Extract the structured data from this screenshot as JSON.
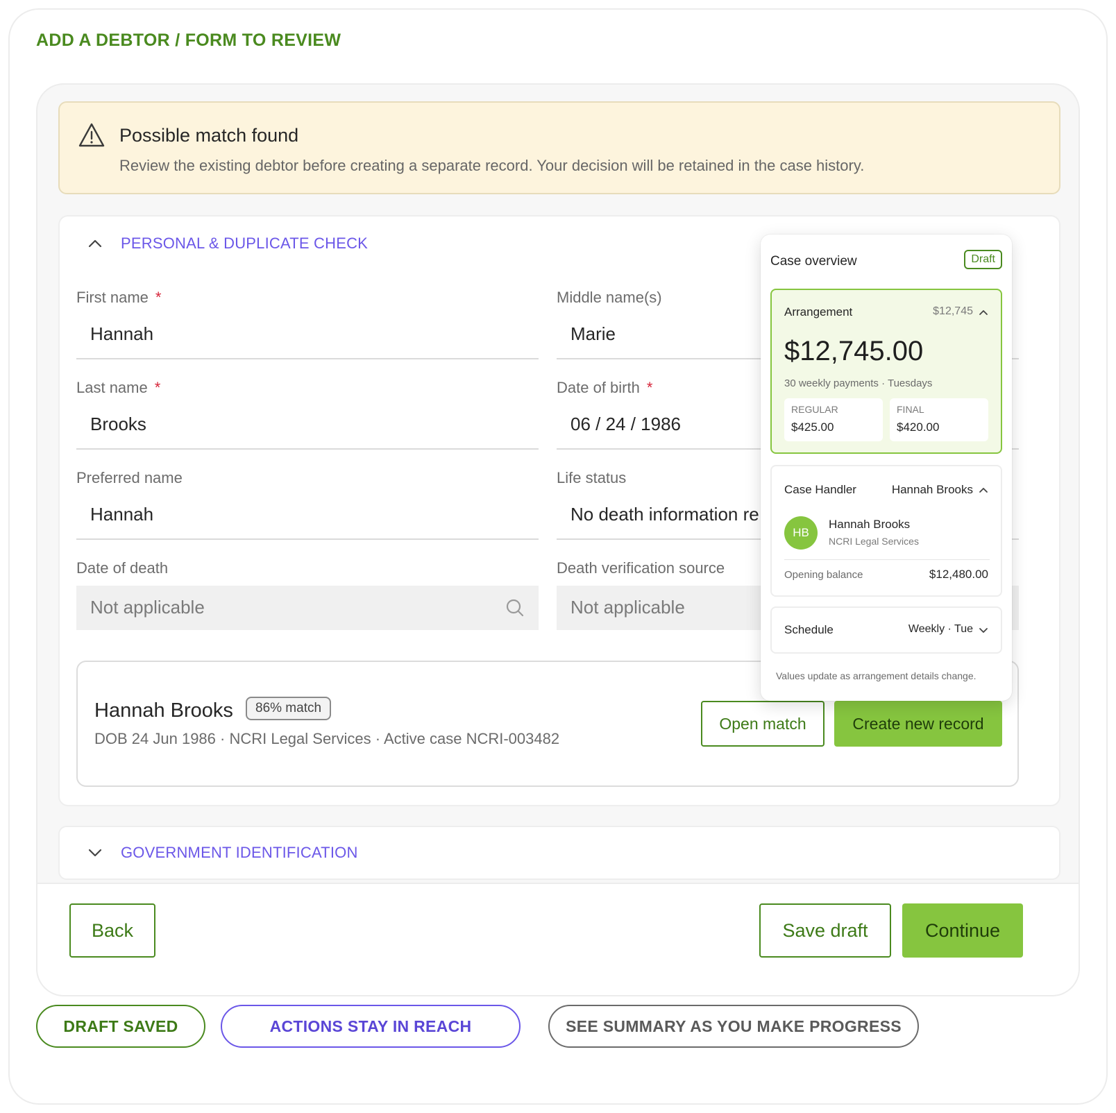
{
  "page": {
    "title": "ADD A DEBTOR / FORM TO REVIEW"
  },
  "alert": {
    "title": "Possible match found",
    "text": "Review the existing debtor before creating a separate record. Your decision will be retained in the case history.",
    "icon": "warning-triangle-icon"
  },
  "sections": {
    "personal": {
      "title": "PERSONAL & DUPLICATE CHECK",
      "expanded": true
    },
    "government": {
      "title": "GOVERNMENT IDENTIFICATION",
      "expanded": false
    }
  },
  "fields": {
    "first_name": {
      "label": "First name",
      "value": "Hannah",
      "required_mark": "*"
    },
    "middle_name": {
      "label": "Middle name(s)",
      "value": "Marie"
    },
    "last_name": {
      "label": "Last name",
      "value": "Brooks",
      "required_mark": "*"
    },
    "dob": {
      "label": "Date of birth",
      "value": "06 / 24 / 1986",
      "required_mark": "*"
    },
    "preferred_name": {
      "label": "Preferred name",
      "value": "Hannah"
    },
    "life_status": {
      "label": "Life status",
      "value": "No death information re"
    },
    "date_of_death": {
      "label": "Date of death",
      "placeholder": "Not applicable"
    },
    "death_source": {
      "label": "Death verification source",
      "placeholder": "Not applicable"
    }
  },
  "match": {
    "name": "Hannah Brooks",
    "badge": "86% match",
    "meta": "DOB 24 Jun 1986 · NCRI Legal Services · Active case NCRI-003482",
    "open_label": "Open match",
    "create_label": "Create new record"
  },
  "footer": {
    "back": "Back",
    "save_draft": "Save draft",
    "continue": "Continue"
  },
  "overview": {
    "title": "Case overview",
    "status": "Draft",
    "arrangement": {
      "label": "Arrangement",
      "summary": "$12,745",
      "total": "$12,745.00",
      "subtitle": "30 weekly payments · Tuesdays",
      "regular_label": "REGULAR",
      "regular_value": "$425.00",
      "final_label": "FINAL",
      "final_value": "$420.00"
    },
    "handler": {
      "label": "Case Handler",
      "summary": "Hannah Brooks",
      "initials": "HB",
      "name": "Hannah Brooks",
      "org": "NCRI Legal Services",
      "balance_label": "Opening balance",
      "balance_value": "$12,480.00"
    },
    "schedule": {
      "label": "Schedule",
      "value": "Weekly · Tue"
    },
    "note": "Values update as arrangement details change."
  },
  "pills": [
    "DRAFT SAVED",
    "ACTIONS STAY IN REACH",
    "SEE SUMMARY AS YOU MAKE PROGRESS"
  ],
  "colors": {
    "accent_green": "#86c53f",
    "text_green": "#4a8a1f",
    "accent_purple": "#6b57e8",
    "alert_bg": "#fdf4dd",
    "required": "#d6263b"
  }
}
